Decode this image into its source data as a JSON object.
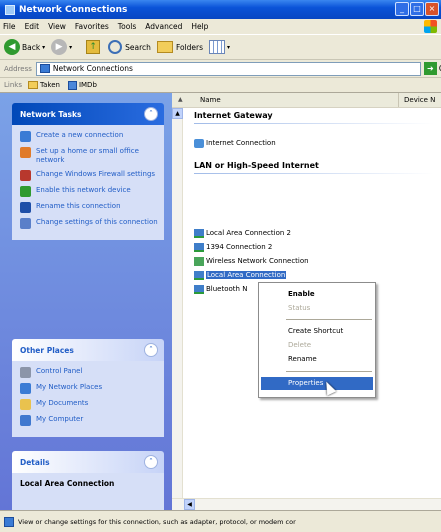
{
  "window": {
    "title": "Network Connections"
  },
  "menu": [
    "File",
    "Edit",
    "View",
    "Favorites",
    "Tools",
    "Advanced",
    "Help"
  ],
  "toolbar": {
    "back": "Back",
    "search": "Search",
    "folders": "Folders"
  },
  "address": {
    "label": "Address",
    "value": "Network Connections",
    "go": "Go"
  },
  "links": {
    "label": "Links",
    "items": [
      "Taken",
      "IMDb"
    ]
  },
  "tasks_panel": {
    "title": "Network Tasks",
    "items": [
      "Create a new connection",
      "Set up a home or small office network",
      "Change Windows Firewall settings",
      "Enable this network device",
      "Rename this connection",
      "Change settings of this connection"
    ]
  },
  "places_panel": {
    "title": "Other Places",
    "items": [
      "Control Panel",
      "My Network Places",
      "My Documents",
      "My Computer"
    ]
  },
  "details_panel": {
    "title": "Details",
    "connection": "Local Area Connection"
  },
  "columns": {
    "name": "Name",
    "device": "Device N"
  },
  "groups": {
    "gateway": {
      "title": "Internet Gateway",
      "items": [
        "Internet Connection"
      ]
    },
    "lan": {
      "title": "LAN or High-Speed Internet",
      "items": [
        "Local Area Connection 2",
        "1394 Connection 2",
        "Wireless Network Connection",
        "Local Area Connection",
        "Bluetooth N"
      ]
    }
  },
  "context_menu": {
    "items": [
      "Enable",
      "Status",
      "Create Shortcut",
      "Delete",
      "Rename",
      "Properties"
    ]
  },
  "status_bar": {
    "text": "View or change settings for this connection, such as adapter, protocol, or modem cor"
  },
  "colors": {
    "selection": "#316ac5",
    "task_pane": "#7ba2e7",
    "title_bar": "#0a53d8"
  }
}
